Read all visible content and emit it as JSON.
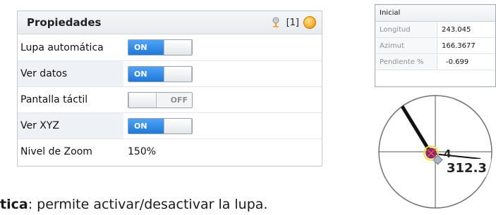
{
  "panel": {
    "title": "Propiedades",
    "badge": "[1]",
    "icons": {
      "pin": "pin-icon",
      "status": "orange-circle-icon"
    },
    "rows": [
      {
        "label": "Lupa automática",
        "type": "toggle",
        "state": "ON"
      },
      {
        "label": "Ver datos",
        "type": "toggle",
        "state": "ON"
      },
      {
        "label": "Pantalla táctil",
        "type": "toggle",
        "state": "OFF"
      },
      {
        "label": "Ver XYZ",
        "type": "toggle",
        "state": "ON"
      },
      {
        "label": "Nivel de Zoom",
        "type": "value",
        "value": "150%"
      }
    ]
  },
  "info": {
    "title": "Inicial",
    "rows": [
      {
        "key": "Longitud",
        "value": "243.045"
      },
      {
        "key": "Azimut",
        "value": "166.3677"
      },
      {
        "key": "Pendiente %",
        "value": "-0.699"
      }
    ]
  },
  "scope": {
    "label_small": "4",
    "label_large": "312.3"
  },
  "caption": {
    "bold": "tica",
    "text": ": permite activar/desactivar la lupa."
  },
  "colors": {
    "toggle_on": "#1f78d8",
    "accent_orange": "#ffb13b",
    "panel_border": "#bfc7d2"
  }
}
